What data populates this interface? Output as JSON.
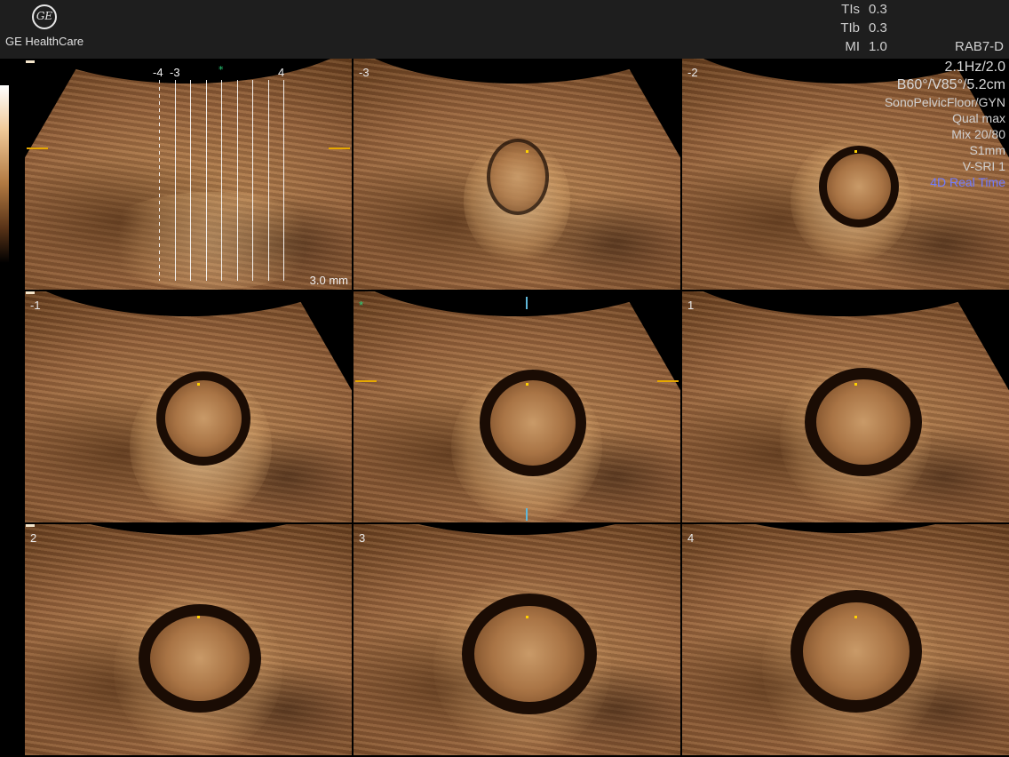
{
  "brand": {
    "logo_mark": "GE",
    "name": "GE HealthCare"
  },
  "indices": [
    {
      "label": "TIs",
      "value": "0.3"
    },
    {
      "label": "TIb",
      "value": "0.3"
    },
    {
      "label": "MI",
      "value": "1.0"
    }
  ],
  "probe": "RAB7-D",
  "params": {
    "frame_rate": "2.1Hz/2.0",
    "geometry": "B60°/V85°/5.2cm",
    "preset": "SonoPelvicFloor/GYN",
    "quality": "Qual max",
    "mix": "Mix 20/80",
    "slice": "S1mm",
    "vsri": "V-SRI 1",
    "mode": "4D Real Time"
  },
  "overview": {
    "labels": {
      "left1": "-4",
      "left2": "-3",
      "right": "4",
      "star": "*"
    },
    "thickness": "3.0 mm"
  },
  "tiles": [
    {
      "label": "-3"
    },
    {
      "label": "-2"
    },
    {
      "label": "-1"
    },
    {
      "label": "*"
    },
    {
      "label": "1"
    },
    {
      "label": "2"
    },
    {
      "label": "3"
    },
    {
      "label": "4"
    }
  ],
  "colors": {
    "accent": "#ffd100",
    "mode_text": "#6f7bff",
    "ref_star": "#29d07a",
    "ref_line": "#5fb7d9"
  }
}
